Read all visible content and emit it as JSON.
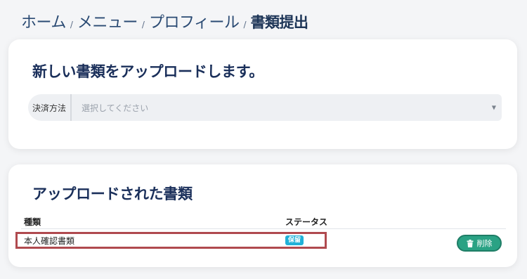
{
  "breadcrumb": {
    "items": [
      "ホーム",
      "メニュー",
      "プロフィール"
    ],
    "separator": "/",
    "current": "書類提出"
  },
  "upload_card": {
    "title": "新しい書類をアップロードします。",
    "field_label": "決済方法",
    "select_placeholder": "選択してください"
  },
  "uploaded_card": {
    "title": "アップロードされた書類",
    "columns": [
      "種類",
      "ステータス"
    ],
    "rows": [
      {
        "type": "本人確認書類",
        "status": "保留",
        "action": "削除"
      }
    ]
  },
  "colors": {
    "badge": "#21b1d8",
    "delete_button": "#2aa284",
    "highlight_outline": "#b04a4f"
  },
  "icons": {
    "select_arrow": "chevron-down-icon",
    "delete": "trash-icon"
  }
}
